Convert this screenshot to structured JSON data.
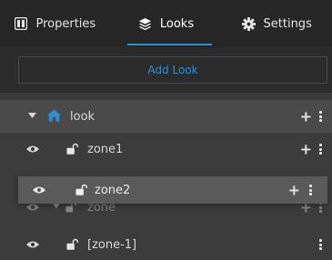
{
  "tabs": [
    {
      "label": "Properties",
      "icon": "properties-icon",
      "active": false
    },
    {
      "label": "Looks",
      "icon": "layers-icon",
      "active": true
    },
    {
      "label": "Settings",
      "icon": "gear-icon",
      "active": false
    }
  ],
  "add_look": {
    "label": "Add Look"
  },
  "tree": {
    "root": {
      "label": "look",
      "icon": "home-icon",
      "expanded": true
    },
    "items": [
      {
        "label": "zone1",
        "locked": false
      },
      {
        "label": "zone",
        "expanded": true,
        "locked": false
      },
      {
        "label": "[zone-1]",
        "locked": false
      }
    ],
    "dragging": {
      "label": "zone2",
      "locked": false
    }
  },
  "colors": {
    "accent": "#2f8fd6",
    "tab_bar_bg": "#262626",
    "panel_bg": "#3c3c3c",
    "row_header_bg": "#4a4a4a",
    "drag_bg": "#5a5a5a"
  }
}
